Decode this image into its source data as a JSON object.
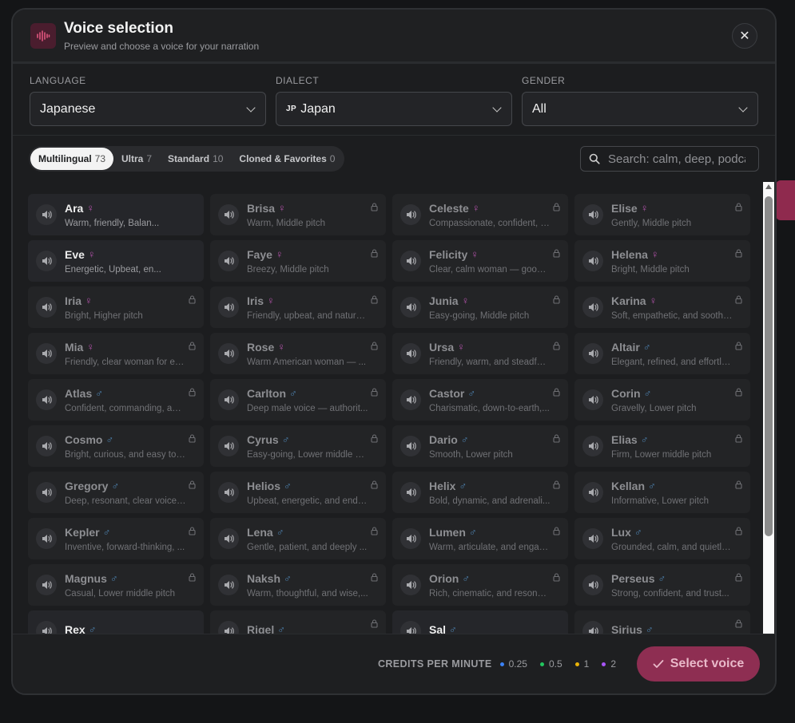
{
  "header": {
    "title": "Voice selection",
    "subtitle": "Preview and choose a voice for your narration",
    "icon": "audio-wave-icon",
    "close_icon": "close-icon",
    "accent": "#c23b6b"
  },
  "filters": {
    "language": {
      "label": "LANGUAGE",
      "value": "Japanese"
    },
    "dialect": {
      "label": "DIALECT",
      "prefix": "JP",
      "value": "Japan"
    },
    "gender": {
      "label": "GENDER",
      "value": "All"
    }
  },
  "tabs": [
    {
      "label": "Multilingual",
      "count": "73",
      "active": true
    },
    {
      "label": "Ultra",
      "count": "7",
      "active": false
    },
    {
      "label": "Standard",
      "count": "10",
      "active": false
    },
    {
      "label": "Cloned & Favorites",
      "count": "0",
      "active": false
    }
  ],
  "search": {
    "placeholder": "Search: calm, deep, podcast"
  },
  "voices": [
    {
      "name": "Ara",
      "gender": "female",
      "desc": "Warm, friendly, Balan...",
      "locked": false
    },
    {
      "name": "Brisa",
      "gender": "female",
      "desc": "Warm, Middle pitch",
      "locked": true
    },
    {
      "name": "Celeste",
      "gender": "female",
      "desc": "Compassionate, confident, a...",
      "locked": true
    },
    {
      "name": "Elise",
      "gender": "female",
      "desc": "Gently, Middle pitch",
      "locked": true
    },
    {
      "name": "Eve",
      "gender": "female",
      "desc": "Energetic, Upbeat, en...",
      "locked": false
    },
    {
      "name": "Faye",
      "gender": "female",
      "desc": "Breezy, Middle pitch",
      "locked": true
    },
    {
      "name": "Felicity",
      "gender": "female",
      "desc": "Clear, calm woman — good ...",
      "locked": true
    },
    {
      "name": "Helena",
      "gender": "female",
      "desc": "Bright, Middle pitch",
      "locked": true
    },
    {
      "name": "Iria",
      "gender": "female",
      "desc": "Bright, Higher pitch",
      "locked": true
    },
    {
      "name": "Iris",
      "gender": "female",
      "desc": "Friendly, upbeat, and natural...",
      "locked": true
    },
    {
      "name": "Junia",
      "gender": "female",
      "desc": "Easy-going, Middle pitch",
      "locked": true
    },
    {
      "name": "Karina",
      "gender": "female",
      "desc": "Soft, empathetic, and soothi...",
      "locked": true
    },
    {
      "name": "Mia",
      "gender": "female",
      "desc": "Friendly, clear woman for ex...",
      "locked": true
    },
    {
      "name": "Rose",
      "gender": "female",
      "desc": "Warm American woman — ...",
      "locked": true
    },
    {
      "name": "Ursa",
      "gender": "female",
      "desc": "Friendly, warm, and steadfas...",
      "locked": true
    },
    {
      "name": "Altair",
      "gender": "male",
      "desc": "Elegant, refined, and effortle...",
      "locked": true
    },
    {
      "name": "Atlas",
      "gender": "male",
      "desc": "Confident, commanding, and...",
      "locked": true
    },
    {
      "name": "Carlton",
      "gender": "male",
      "desc": "Deep male voice — authorit...",
      "locked": true
    },
    {
      "name": "Castor",
      "gender": "male",
      "desc": "Charismatic, down-to-earth,...",
      "locked": true
    },
    {
      "name": "Corin",
      "gender": "male",
      "desc": "Gravelly, Lower pitch",
      "locked": true
    },
    {
      "name": "Cosmo",
      "gender": "male",
      "desc": "Bright, curious, and easy to f...",
      "locked": true
    },
    {
      "name": "Cyrus",
      "gender": "male",
      "desc": "Easy-going, Lower middle pi...",
      "locked": true
    },
    {
      "name": "Dario",
      "gender": "male",
      "desc": "Smooth, Lower pitch",
      "locked": true
    },
    {
      "name": "Elias",
      "gender": "male",
      "desc": "Firm, Lower middle pitch",
      "locked": true
    },
    {
      "name": "Gregory",
      "gender": "male",
      "desc": "Deep, resonant, clear voice f...",
      "locked": true
    },
    {
      "name": "Helios",
      "gender": "male",
      "desc": "Upbeat, energetic, and endle...",
      "locked": true
    },
    {
      "name": "Helix",
      "gender": "male",
      "desc": "Bold, dynamic, and adrenali...",
      "locked": true
    },
    {
      "name": "Kellan",
      "gender": "male",
      "desc": "Informative, Lower pitch",
      "locked": true
    },
    {
      "name": "Kepler",
      "gender": "male",
      "desc": "Inventive, forward-thinking, ...",
      "locked": true
    },
    {
      "name": "Lena",
      "gender": "male",
      "desc": "Gentle, patient, and deeply ...",
      "locked": true
    },
    {
      "name": "Lumen",
      "gender": "male",
      "desc": "Warm, articulate, and engag...",
      "locked": true
    },
    {
      "name": "Lux",
      "gender": "male",
      "desc": "Grounded, calm, and quietly ...",
      "locked": true
    },
    {
      "name": "Magnus",
      "gender": "male",
      "desc": "Casual, Lower middle pitch",
      "locked": true
    },
    {
      "name": "Naksh",
      "gender": "male",
      "desc": "Warm, thoughtful, and wise,...",
      "locked": true
    },
    {
      "name": "Orion",
      "gender": "male",
      "desc": "Rich, cinematic, and resonan...",
      "locked": true
    },
    {
      "name": "Perseus",
      "gender": "male",
      "desc": "Strong, confident, and trust...",
      "locked": true
    },
    {
      "name": "Rex",
      "gender": "male",
      "desc": "",
      "locked": false
    },
    {
      "name": "Rigel",
      "gender": "male",
      "desc": "",
      "locked": true
    },
    {
      "name": "Sal",
      "gender": "male",
      "desc": "",
      "locked": false
    },
    {
      "name": "Sirius",
      "gender": "male",
      "desc": "",
      "locked": true
    }
  ],
  "footer": {
    "credits_label": "CREDITS PER MINUTE",
    "credits": [
      {
        "value": "0.25",
        "color": "#3b82f6"
      },
      {
        "value": "0.5",
        "color": "#22c55e"
      },
      {
        "value": "1",
        "color": "#eab308"
      },
      {
        "value": "2",
        "color": "#a855f7"
      }
    ],
    "select_label": "Select voice",
    "select_icon": "check-icon",
    "button_color": "#8e2e52"
  }
}
